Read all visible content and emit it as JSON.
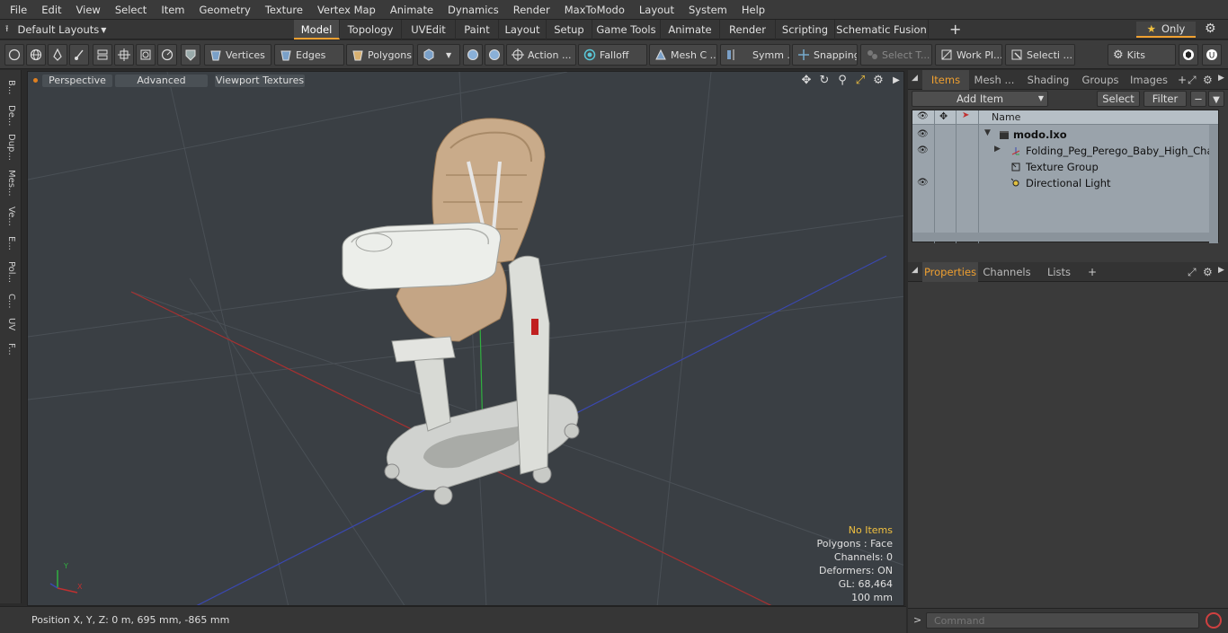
{
  "menubar": {
    "items": [
      "File",
      "Edit",
      "View",
      "Select",
      "Item",
      "Geometry",
      "Texture",
      "Vertex Map",
      "Animate",
      "Dynamics",
      "Render",
      "MaxToModo",
      "Layout",
      "System",
      "Help"
    ]
  },
  "layoutbar": {
    "layout_selector": "Default Layouts",
    "tabs": [
      "Model",
      "Topology",
      "UVEdit",
      "Paint",
      "Layout",
      "Setup",
      "Game Tools",
      "Animate",
      "Render",
      "Scripting",
      "Schematic Fusion"
    ],
    "active_tab": "Model",
    "plus": "+",
    "only_label": "Only"
  },
  "toolbar": {
    "vertices": "Vertices",
    "edges": "Edges",
    "polygons": "Polygons",
    "action": "Action ...",
    "falloff": "Falloff",
    "mesh_c": "Mesh C ...",
    "symm": "Symm ...",
    "snapping": "Snapping",
    "select_t": "Select T...",
    "work_pl": "Work Pl...",
    "selecti": "Selecti ...",
    "kits": "Kits"
  },
  "leftstrip": {
    "tabs": [
      "B...",
      "De...",
      "Dup...",
      "Mes...",
      "Ve...",
      "E...",
      "Pol...",
      "C...",
      "UV",
      "F..."
    ]
  },
  "viewport": {
    "perspective": "Perspective",
    "advanced": "Advanced",
    "viewport_textures": "Viewport Textures",
    "info": {
      "no_items": "No Items",
      "polygons": "Polygons : Face",
      "channels": "Channels: 0",
      "deformers": "Deformers: ON",
      "gl": "GL: 68,464",
      "scale": "100 mm"
    }
  },
  "statusbar": {
    "position": "Position X, Y, Z:   0 m, 695 mm, -865 mm"
  },
  "items_panel": {
    "tabs": [
      "Items",
      "Mesh ...",
      "Shading",
      "Groups",
      "Images"
    ],
    "active_tab": "Items",
    "add_item": "Add Item",
    "select": "Select",
    "filter": "Filter",
    "name_header": "Name",
    "tree": [
      {
        "label": "modo.lxo",
        "level": 0
      },
      {
        "label": "Folding_Peg_Perego_Baby_High_Chair_...",
        "level": 1
      },
      {
        "label": "Texture Group",
        "level": 1
      },
      {
        "label": "Directional Light",
        "level": 1
      }
    ]
  },
  "properties_panel": {
    "tabs": [
      "Properties",
      "Channels",
      "Lists"
    ],
    "active_tab": "Properties",
    "plus": "+"
  },
  "command": {
    "placeholder": "Command"
  },
  "colors": {
    "accent": "#f0a030",
    "viewport_bg": "#3a3f44",
    "info_highlight": "#f0c040",
    "axis_red": "#c03030",
    "axis_blue": "#3040b0",
    "axis_green": "#30b040"
  }
}
